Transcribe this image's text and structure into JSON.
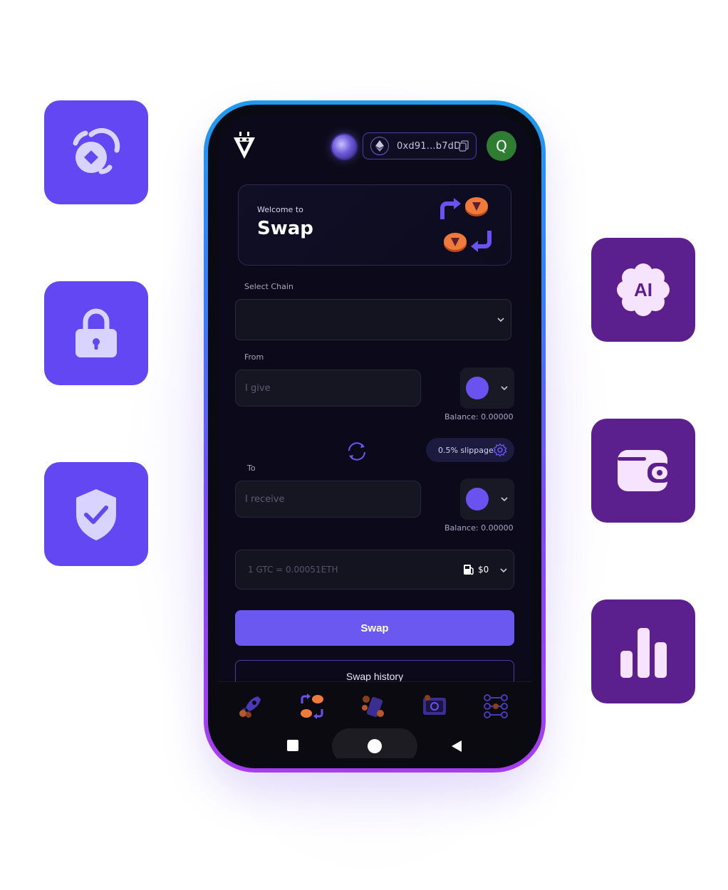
{
  "header": {
    "wallet_address": "0xd91...b7dD",
    "user_initial": "Q"
  },
  "welcome": {
    "small": "Welcome to",
    "title": "Swap"
  },
  "form": {
    "select_chain_label": "Select Chain",
    "select_chain_value": "",
    "from_label": "From",
    "from_placeholder": "I give",
    "from_balance": "Balance: 0.00000",
    "slippage": "0.5% slippage",
    "to_label": "To",
    "to_placeholder": "I receive",
    "to_balance": "Balance: 0.00000",
    "rate": "1 GTC = 0.00051ETH",
    "gas_value": "$0",
    "swap_button": "Swap",
    "history_button": "Swap history"
  },
  "feature_tiles": [
    {
      "icon": "coin-swap-icon",
      "color": "#6347f2"
    },
    {
      "icon": "lock-icon",
      "color": "#6347f2"
    },
    {
      "icon": "shield-check-icon",
      "color": "#6347f2"
    },
    {
      "icon": "ai-icon",
      "color": "#5b1f8e",
      "label": "AI"
    },
    {
      "icon": "wallet-icon",
      "color": "#5b1f8e"
    },
    {
      "icon": "bar-chart-icon",
      "color": "#5b1f8e"
    }
  ],
  "bottom_nav": [
    {
      "icon": "rocket-icon"
    },
    {
      "icon": "swap-coins-icon"
    },
    {
      "icon": "phone-coins-icon"
    },
    {
      "icon": "vault-icon"
    },
    {
      "icon": "network-icon"
    }
  ],
  "colors": {
    "accent": "#6a58f0",
    "tile_blue": "#6347f2",
    "tile_purple": "#5b1f8e",
    "avatar_green": "#2e7d32"
  }
}
